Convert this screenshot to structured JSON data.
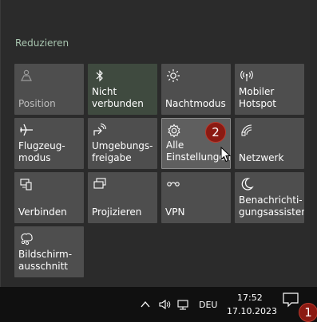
{
  "panel": {
    "collapse_label": "Reduzieren"
  },
  "tiles": [
    {
      "label": "Position",
      "icon": "location-person-icon",
      "state": "off"
    },
    {
      "label": "Nicht\nverbunden",
      "icon": "bluetooth-icon",
      "state": "on"
    },
    {
      "label": "Nachtmodus",
      "icon": "brightness-icon",
      "state": "off"
    },
    {
      "label": "Mobiler\nHotspot",
      "icon": "hotspot-icon",
      "state": "off"
    },
    {
      "label": "Flugzeug-\nmodus",
      "icon": "airplane-icon",
      "state": "off"
    },
    {
      "label": "Umgebungs-\nfreigabe",
      "icon": "share-icon",
      "state": "off"
    },
    {
      "label": "Alle\nEinstellungen",
      "icon": "gear-icon",
      "state": "hover"
    },
    {
      "label": "Netzwerk",
      "icon": "network-icon",
      "state": "off"
    },
    {
      "label": "Verbinden",
      "icon": "connect-icon",
      "state": "off"
    },
    {
      "label": "Projizieren",
      "icon": "project-icon",
      "state": "off"
    },
    {
      "label": "VPN",
      "icon": "vpn-icon",
      "state": "off"
    },
    {
      "label": "Benachrichti-\ngungsassistent",
      "icon": "moon-icon",
      "state": "off"
    },
    {
      "label": "Bildschirm-\nausschnitt",
      "icon": "snip-icon",
      "state": "off"
    }
  ],
  "badges": {
    "settings_badge": "2",
    "action_center_badge": "1"
  },
  "taskbar": {
    "language": "DEU",
    "time": "17:52",
    "date": "17.10.2023"
  }
}
